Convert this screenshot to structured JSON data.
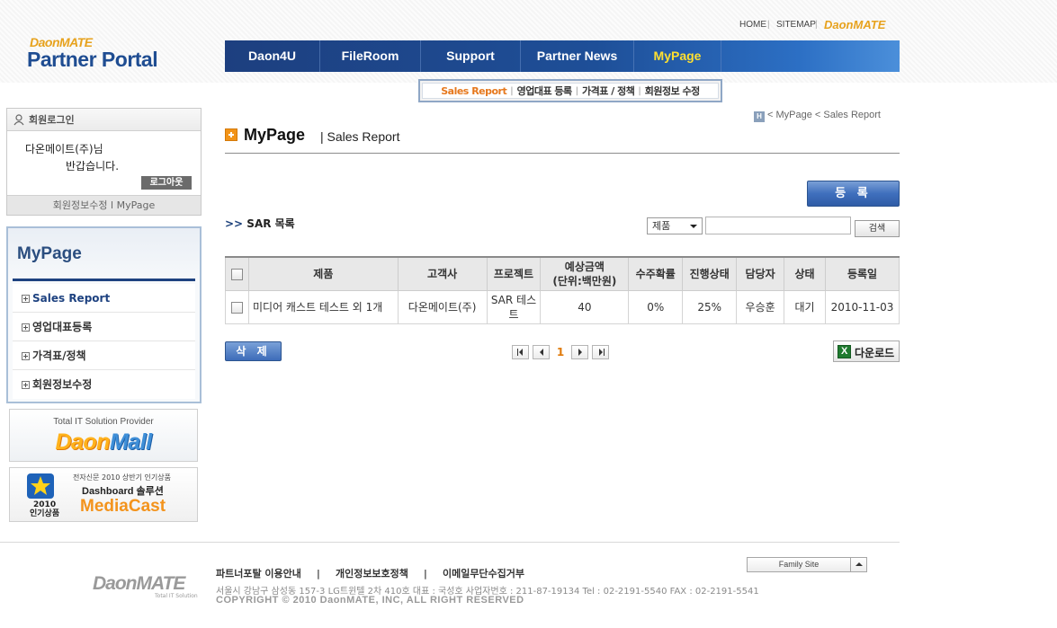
{
  "header": {
    "brand_top": "DaonMATE",
    "portal_title": "Partner Portal",
    "util_home": "HOME",
    "util_sitemap": "SITEMAP",
    "util_brand": "DaonMATE"
  },
  "gnb": {
    "items": [
      "Daon4U",
      "FileRoom",
      "Support",
      "Partner News",
      "MyPage"
    ],
    "active": "MyPage",
    "active_color": "#ffe030"
  },
  "subnav": {
    "items": [
      "Sales Report",
      "영업대표 등록",
      "가격표 / 정책",
      "회원정보 수정"
    ],
    "active_color": "#e6781d"
  },
  "login": {
    "title": "회원로그인",
    "user_line": "다온메이트(주)님",
    "greeting": "반갑습니다.",
    "logout": "로그아웃",
    "footer_link1": "회원정보수정",
    "footer_sep": "l",
    "footer_link2": "MyPage"
  },
  "lnb": {
    "title": "MyPage",
    "items": [
      "Sales Report",
      "영업대표등록",
      "가격표/정책",
      "회원정보수정"
    ]
  },
  "banners": {
    "mall_tagline": "Total IT Solution Provider",
    "mall_name_a": "Daon",
    "mall_name_b": "Mall",
    "cast_tag": "전자신문 2010 상반기 인기상품",
    "cast_line": "Dashboard 솔루션",
    "cast_name": "MediaCast",
    "cast_year": "2010",
    "cast_award": "인기상품"
  },
  "breadcrumb": {
    "home": "H",
    "path": "< MyPage < Sales Report"
  },
  "page": {
    "title": "MyPage",
    "subtitle": "| Sales Report",
    "register_button": "등 록",
    "list_arrow": ">>",
    "list_title": "SAR 목록"
  },
  "search": {
    "select_value": "제품",
    "input_value": "",
    "button": "검색"
  },
  "table": {
    "headers": [
      "제품",
      "고객사",
      "프로젝트",
      "예상금액\n(단위:백만원)",
      "수주확률",
      "진행상태",
      "담당자",
      "상태",
      "등록일"
    ],
    "header_amount_1": "예상금액",
    "header_amount_2": "(단위:백만원)",
    "rows": [
      {
        "product": "미디어 캐스트 테스트 외 1개",
        "customer": "다온메이트(주)",
        "project": "SAR 테스트",
        "amount": "40",
        "probability": "0%",
        "progress": "25%",
        "manager": "우승훈",
        "status": "대기",
        "date": "2010-11-03"
      }
    ]
  },
  "actions": {
    "delete_button": "삭 제",
    "download_button": "다운로드",
    "current_page": "1"
  },
  "footer": {
    "links": [
      "파트너포탈 이용안내",
      "개인정보보호정책",
      "이메일무단수집거부"
    ],
    "sep": "|",
    "address": "서울시 강남구 삼성동 157-3 LG트윈텔 2차 410호    대표 : 국성호  사업자번호 : 211-87-19134    Tel : 02-2191-5540    FAX : 02-2191-5541",
    "copyright": "COPYRIGHT © 2010 DaonMATE, INC, ALL RIGHT RESERVED",
    "logo": "DaonMATE",
    "logo_sub": "Total IT Solution",
    "family_site": "Family Site"
  }
}
